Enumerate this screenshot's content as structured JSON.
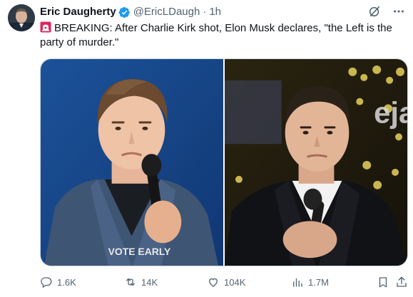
{
  "post": {
    "author_name": "Eric Daugherty",
    "handle": "@EricLDaugh",
    "separator": "·",
    "time": "1h",
    "text": "BREAKING: After Charlie Kirk shot, Elon Musk declares, \"the Left is the party of murder.\"",
    "emoji": "siren-icon",
    "verified_color": "#1d9bf0"
  },
  "media": {
    "left_shirt_text": "VOTE EARLY",
    "right_sign_text": "eja"
  },
  "actions": {
    "replies": "1.6K",
    "reposts": "14K",
    "likes": "104K",
    "views": "1.7M"
  },
  "colors": {
    "text_primary": "#0f1419",
    "text_secondary": "#536471",
    "border": "#cfd9de",
    "accent": "#1d9bf0"
  },
  "icons": {
    "grok": "grok-icon",
    "more": "more-icon",
    "reply": "reply-icon",
    "repost": "repost-icon",
    "like": "heart-icon",
    "views": "views-icon",
    "bookmark": "bookmark-icon",
    "share": "share-icon"
  }
}
